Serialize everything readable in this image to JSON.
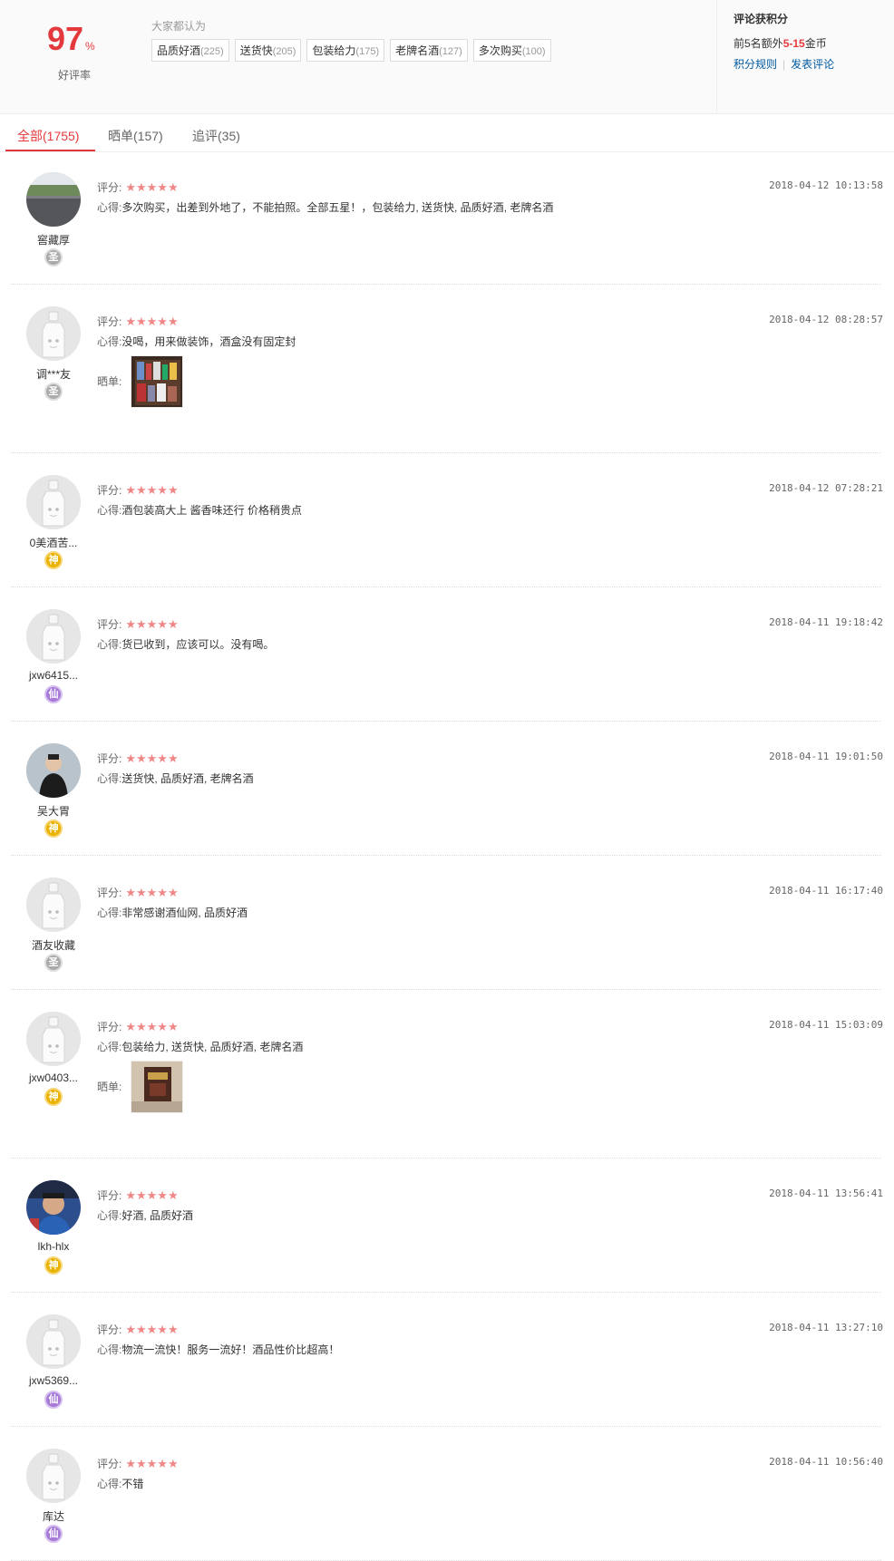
{
  "summary": {
    "rate_value": "97",
    "rate_unit": "%",
    "rate_label": "好评率",
    "tags_head": "大家都认为",
    "tags": [
      {
        "label": "品质好酒",
        "count": "(225)"
      },
      {
        "label": "送货快",
        "count": "(205)"
      },
      {
        "label": "包装给力",
        "count": "(175)"
      },
      {
        "label": "老牌名酒",
        "count": "(127)"
      },
      {
        "label": "多次购买",
        "count": "(100)"
      }
    ],
    "points": {
      "title": "评论获积分",
      "line_prefix": "前5名额外",
      "line_highlight": "5-15",
      "line_suffix": "金币",
      "rules_link": "积分规则",
      "separator": "|",
      "post_link": "发表评论"
    }
  },
  "tabs": [
    {
      "label": "全部(1755)"
    },
    {
      "label": "晒单(157)"
    },
    {
      "label": "追评(35)"
    }
  ],
  "labels": {
    "score": "评分:",
    "comment": "心得:",
    "show": "晒单:",
    "stars": "★★★★★"
  },
  "reviews": [
    {
      "user": "窖藏厚",
      "level": "圣",
      "date": "2018-04-12 10:13:58",
      "text": "多次购买，出差到外地了，不能拍照。全部五星！，包装给力, 送货快, 品质好酒, 老牌名酒",
      "avatar": "photo-road"
    },
    {
      "user": "调***友",
      "level": "圣",
      "date": "2018-04-12 08:28:57",
      "text": "没喝，用来做装饰，酒盒没有固定封",
      "avatar": "default",
      "thumb": "shelf"
    },
    {
      "user": "0美酒苦...",
      "level": "神",
      "date": "2018-04-12 07:28:21",
      "text": "酒包装高大上  酱香味还行  价格稍贵点",
      "avatar": "default"
    },
    {
      "user": "jxw6415...",
      "level": "仙",
      "date": "2018-04-11 19:18:42",
      "text": "货已收到，应该可以。没有喝。",
      "avatar": "default"
    },
    {
      "user": "吴大胃",
      "level": "神",
      "date": "2018-04-11 19:01:50",
      "text": "送货快, 品质好酒, 老牌名酒",
      "avatar": "photo-person"
    },
    {
      "user": "酒友收藏",
      "level": "圣",
      "date": "2018-04-11 16:17:40",
      "text": "非常感谢酒仙网, 品质好酒",
      "avatar": "default"
    },
    {
      "user": "jxw0403...",
      "level": "神",
      "date": "2018-04-11 15:03:09",
      "text": "包装给力, 送货快, 品质好酒, 老牌名酒",
      "avatar": "default",
      "thumb": "box"
    },
    {
      "user": "lkh-hlx",
      "level": "神",
      "date": "2018-04-11 13:56:41",
      "text": "好酒, 品质好酒",
      "avatar": "photo-man"
    },
    {
      "user": "jxw5369...",
      "level": "仙",
      "date": "2018-04-11 13:27:10",
      "text": "物流一流快！服务一流好！酒品性价比超高！",
      "avatar": "default"
    },
    {
      "user": "库达",
      "level": "仙",
      "date": "2018-04-11 10:56:40",
      "text": "不错",
      "avatar": "default"
    }
  ],
  "colors": {
    "accent": "#e4393c",
    "star": "#f08787",
    "link": "#005aa0"
  }
}
